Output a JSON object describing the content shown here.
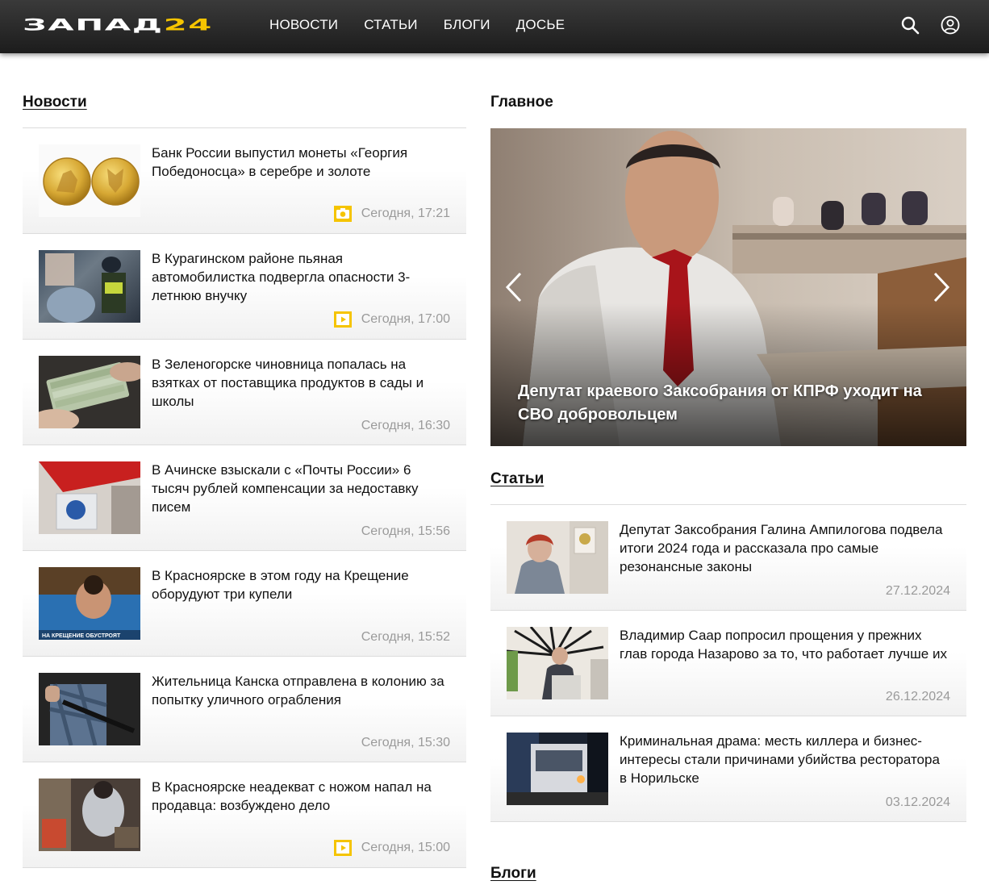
{
  "header": {
    "logo_text_a": "ЗАПАД",
    "logo_text_b": "24",
    "nav": [
      "НОВОСТИ",
      "СТАТЬИ",
      "БЛОГИ",
      "ДОСЬЕ"
    ],
    "search_icon": "search-icon",
    "user_icon": "user-icon"
  },
  "news": {
    "title": "Новости",
    "items": [
      {
        "title": "Банк России выпустил монеты «Георгия Победоносца» в серебре и золоте",
        "date": "Сегодня, 17:21",
        "badge": "photo"
      },
      {
        "title": "В Курагинском районе пьяная автомобилистка подвергла опасности 3-летнюю внучку",
        "date": "Сегодня, 17:00",
        "badge": "video"
      },
      {
        "title": "В Зеленогорске чиновница попалась на взятках от поставщика продуктов в сады и школы",
        "date": "Сегодня, 16:30",
        "badge": ""
      },
      {
        "title": "В Ачинске взыскали с «Почты России» 6 тысяч рублей компенсации за недоставку писем",
        "date": "Сегодня, 15:56",
        "badge": ""
      },
      {
        "title": "В Красноярске в этом году на Крещение оборудуют три купели",
        "date": "Сегодня, 15:52",
        "badge": "",
        "thumb_caption": "НА КРЕЩЕНИЕ ОБУСТРОЯТ"
      },
      {
        "title": "Жительница Канска отправлена в колонию за попытку уличного ограбления",
        "date": "Сегодня, 15:30",
        "badge": ""
      },
      {
        "title": "В Красноярске неадекват с ножом напал на продавца: возбуждено дело",
        "date": "Сегодня, 15:00",
        "badge": "video"
      }
    ]
  },
  "main": {
    "title": "Главное",
    "caption": "Депутат краевого Заксобрания от КПРФ уходит на СВО добровольцем"
  },
  "articles": {
    "title": "Статьи",
    "items": [
      {
        "title": "Депутат Заксобрания Галина Ампилогова подвела итоги 2024 года и рассказала про самые резонансные законы",
        "date": "27.12.2024"
      },
      {
        "title": "Владимир Саар попросил прощения у прежних глав города Назарово за то, что работает лучше их",
        "date": "26.12.2024"
      },
      {
        "title": "Криминальная драма: месть киллера и бизнес-интересы стали причинами убийства ресторатора в Норильске",
        "date": "03.12.2024"
      }
    ]
  },
  "blogs": {
    "title": "Блоги"
  },
  "colors": {
    "accent": "#f5c400",
    "header_bg": "#2a2a2a",
    "date": "#9a9a9a"
  }
}
